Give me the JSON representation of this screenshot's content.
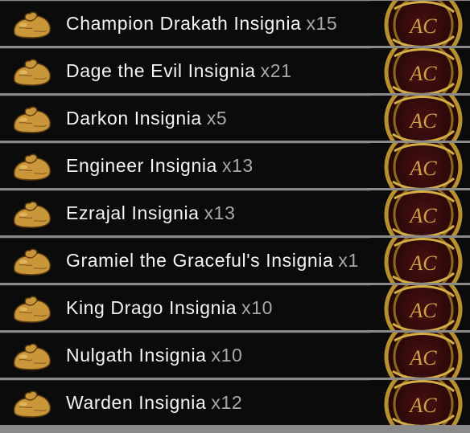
{
  "items": [
    {
      "name": "Champion Drakath Insignia",
      "qty": "x15",
      "icon": "item-bag-icon",
      "badge": "ac-badge-icon"
    },
    {
      "name": "Dage the Evil Insignia",
      "qty": "x21",
      "icon": "item-bag-icon",
      "badge": "ac-badge-icon"
    },
    {
      "name": "Darkon Insignia",
      "qty": "x5",
      "icon": "item-bag-icon",
      "badge": "ac-badge-icon"
    },
    {
      "name": "Engineer Insignia",
      "qty": "x13",
      "icon": "item-bag-icon",
      "badge": "ac-badge-icon"
    },
    {
      "name": "Ezrajal Insignia",
      "qty": "x13",
      "icon": "item-bag-icon",
      "badge": "ac-badge-icon"
    },
    {
      "name": "Gramiel the Graceful's Insignia",
      "qty": "x1",
      "icon": "item-bag-icon",
      "badge": "ac-badge-icon"
    },
    {
      "name": "King Drago Insignia",
      "qty": "x10",
      "icon": "item-bag-icon",
      "badge": "ac-badge-icon"
    },
    {
      "name": "Nulgath Insignia",
      "qty": "x10",
      "icon": "item-bag-icon",
      "badge": "ac-badge-icon"
    },
    {
      "name": "Warden Insignia",
      "qty": "x12",
      "icon": "item-bag-icon",
      "badge": "ac-badge-icon"
    }
  ],
  "badge_text": "AC",
  "colors": {
    "row_bg": "#0b0b0b",
    "separator": "#8a8a8a",
    "name_text": "#f4f4f4",
    "qty_text": "#a9a9a9",
    "bag": "#c9973a",
    "badge_dark": "#3a0d0d",
    "badge_gold": "#b8912f"
  }
}
